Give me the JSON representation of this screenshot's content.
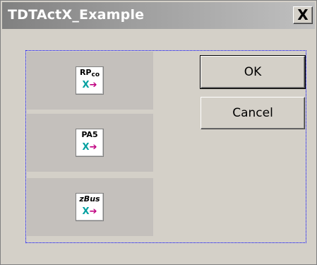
{
  "window": {
    "title": "TDTActX_Example",
    "close_glyph": "X"
  },
  "controls": [
    {
      "label_parts": [
        "RP",
        "co"
      ],
      "icon": "rpco-activex-icon"
    },
    {
      "label": "PA5",
      "icon": "pa5-activex-icon"
    },
    {
      "label": "zBus",
      "icon": "zbus-activex-icon"
    }
  ],
  "control_glyph": {
    "x": "X",
    "arrow": "➔"
  },
  "buttons": {
    "ok_label": "OK",
    "cancel_label": "Cancel"
  },
  "colors": {
    "dialog_bg": "#d4d0c8",
    "focus_outline": "#0000ff",
    "glyph_x": "#00a0a0",
    "glyph_arrow": "#c00080"
  }
}
